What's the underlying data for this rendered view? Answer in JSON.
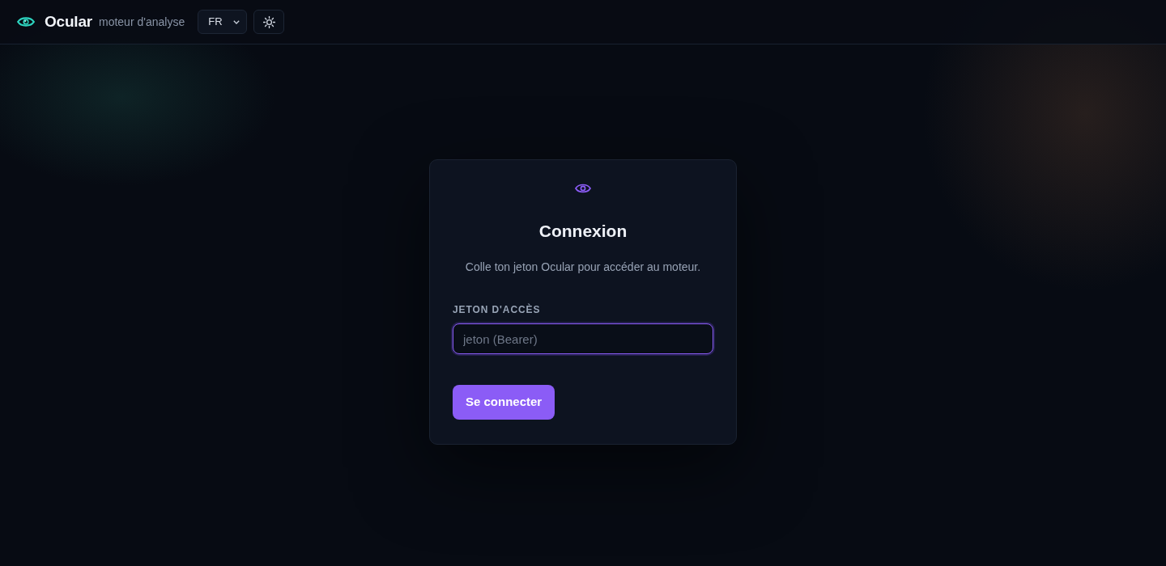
{
  "header": {
    "brand": "Ocular",
    "tagline": "moteur d'analyse",
    "language": {
      "value": "FR"
    }
  },
  "login": {
    "title": "Connexion",
    "subtitle": "Colle ton jeton Ocular pour accéder au moteur.",
    "token_field": {
      "label": "JETON D'ACCÈS",
      "placeholder": "jeton (Bearer)",
      "focused": true
    },
    "submit": "Se connecter"
  }
}
